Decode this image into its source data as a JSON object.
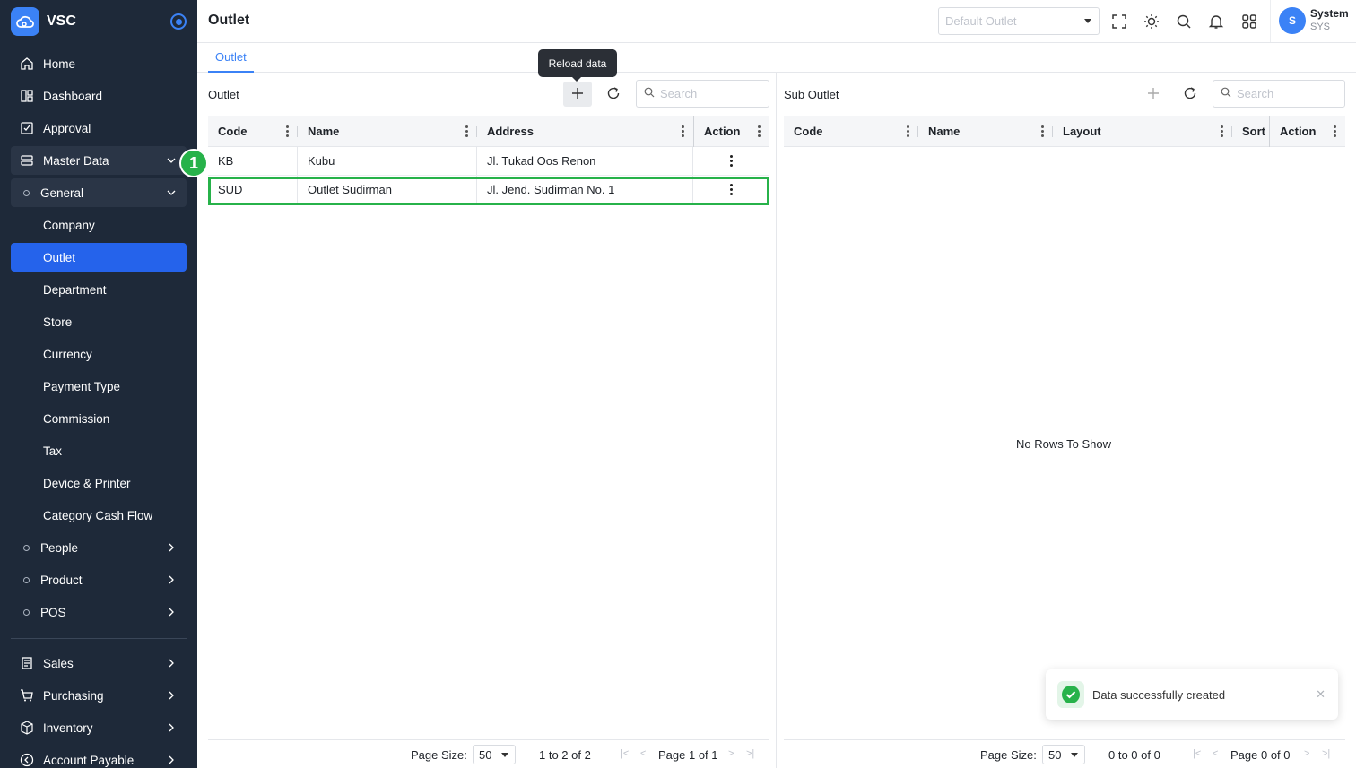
{
  "app": {
    "name": "VSC"
  },
  "sidebar": {
    "top": [
      {
        "label": "Home",
        "icon": "home-icon"
      },
      {
        "label": "Dashboard",
        "icon": "dashboard-icon"
      },
      {
        "label": "Approval",
        "icon": "approval-icon"
      }
    ],
    "master_data": "Master Data",
    "general": "General",
    "general_items": [
      "Company",
      "Outlet",
      "Department",
      "Store",
      "Currency",
      "Payment Type",
      "Commission",
      "Tax",
      "Device & Printer",
      "Category Cash Flow"
    ],
    "sub_groups": [
      "People",
      "Product",
      "POS"
    ],
    "bottom": [
      {
        "label": "Sales",
        "icon": "sales-icon"
      },
      {
        "label": "Purchasing",
        "icon": "cart-icon"
      },
      {
        "label": "Inventory",
        "icon": "box-icon"
      },
      {
        "label": "Account Payable",
        "icon": "payable-icon"
      }
    ],
    "step_badge": "1"
  },
  "header": {
    "title": "Outlet",
    "outlet_select": {
      "placeholder": "Default Outlet",
      "value": ""
    },
    "user": {
      "initial": "S",
      "name": "System",
      "code": "SYS"
    }
  },
  "tabs": [
    "Outlet"
  ],
  "tooltip": "Reload data",
  "outlet_panel": {
    "title": "Outlet",
    "search_placeholder": "Search",
    "columns": [
      "Code",
      "Name",
      "Address",
      "Action"
    ],
    "rows": [
      {
        "code": "KB",
        "name": "Kubu",
        "address": "Jl. Tukad Oos Renon"
      },
      {
        "code": "SUD",
        "name": "Outlet Sudirman",
        "address": "Jl. Jend. Sudirman No. 1"
      }
    ],
    "footer": {
      "page_size_label": "Page Size:",
      "page_size": "50",
      "range": "1 to 2 of 2",
      "page": "Page 1 of 1"
    }
  },
  "sub_outlet_panel": {
    "title": "Sub Outlet",
    "search_placeholder": "Search",
    "columns": [
      "Code",
      "Name",
      "Layout",
      "Sort",
      "Action"
    ],
    "empty": "No Rows To Show",
    "footer": {
      "page_size_label": "Page Size:",
      "page_size": "50",
      "range": "0 to 0 of 0",
      "page": "Page 0 of 0"
    }
  },
  "toast": {
    "message": "Data successfully created"
  },
  "colors": {
    "sidebar_bg": "#1e2939",
    "accent": "#2563eb",
    "highlight": "#27b24a"
  }
}
